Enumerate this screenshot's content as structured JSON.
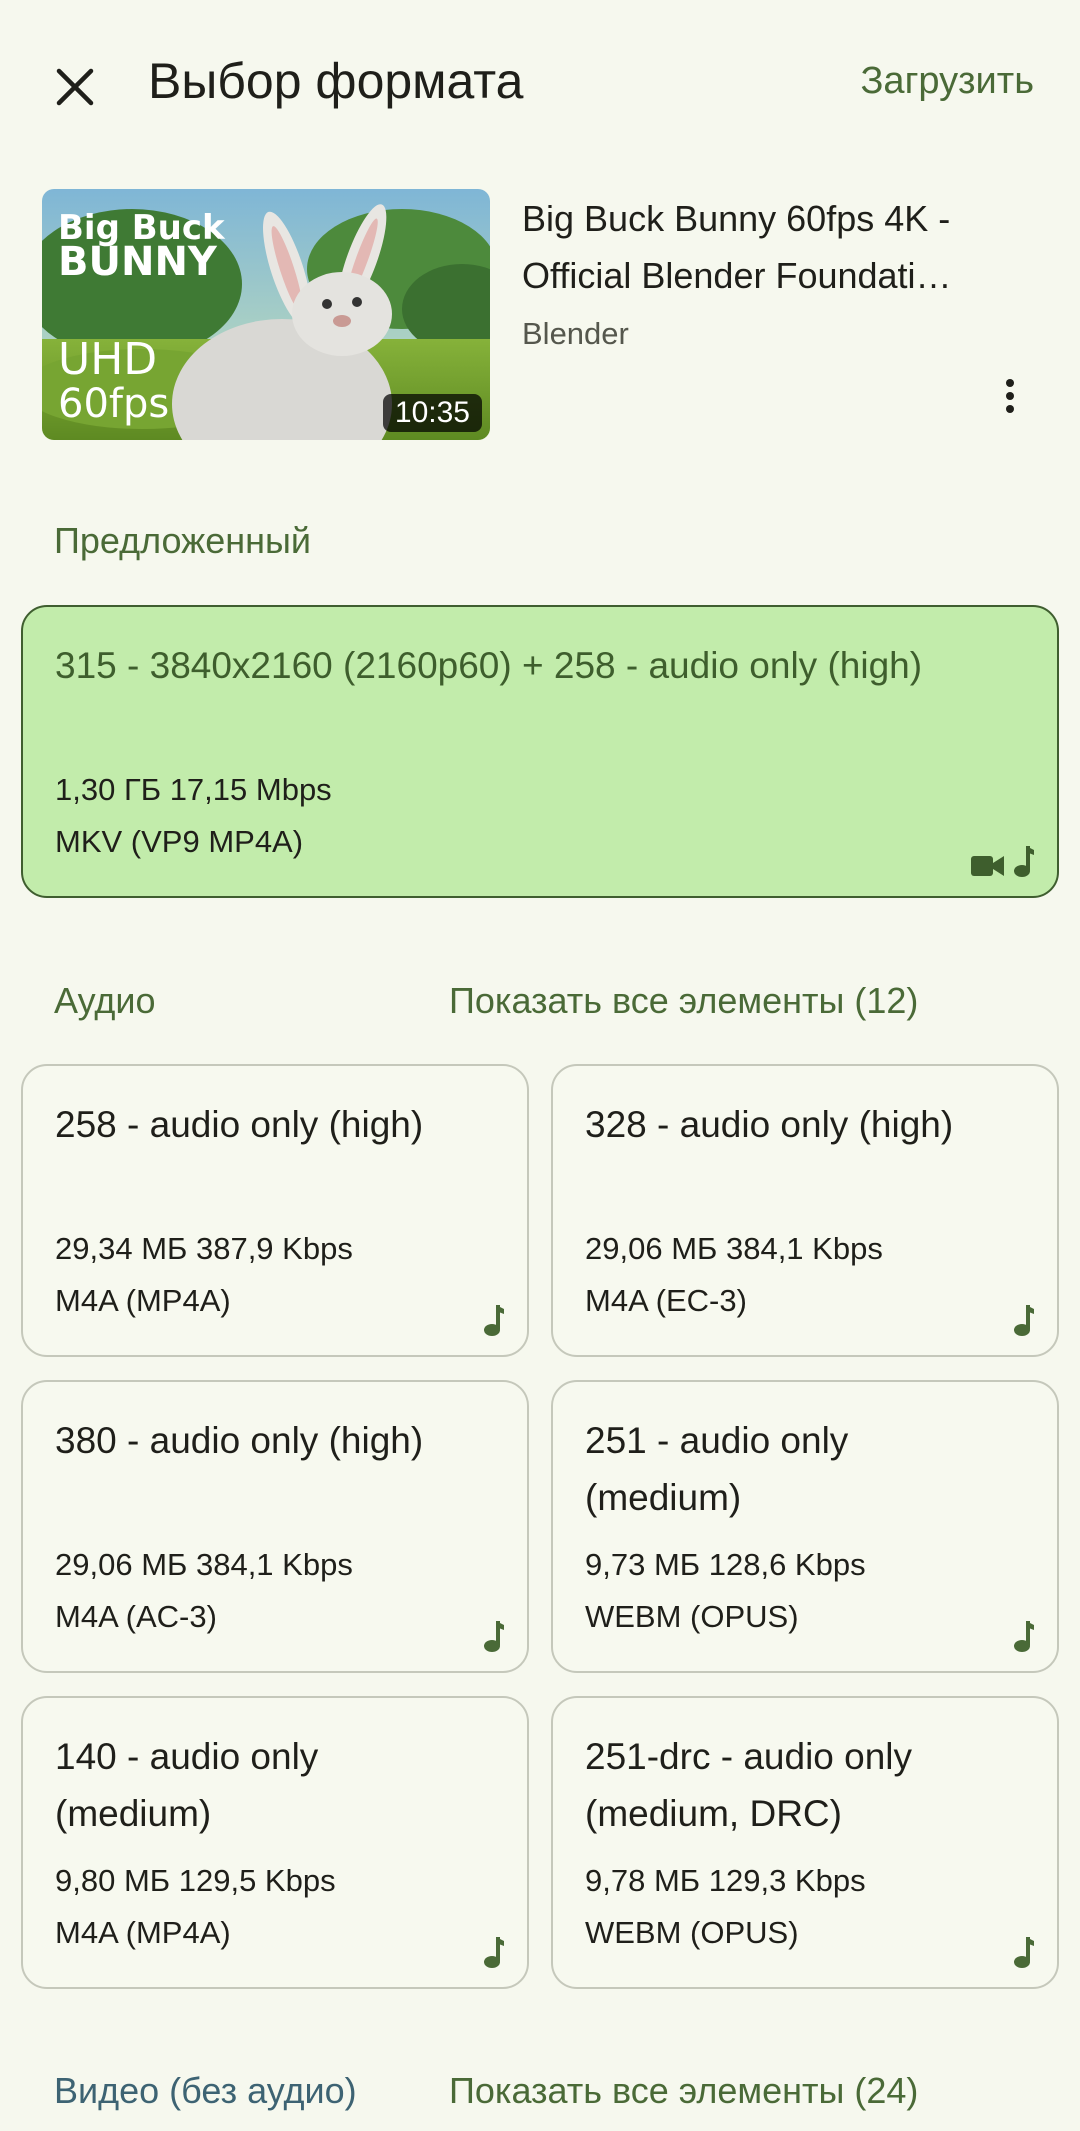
{
  "header": {
    "title": "Выбор формата",
    "download_label": "Загрузить"
  },
  "video": {
    "title_line1": "Big Buck Bunny 60fps 4K -",
    "title_line2": "Official Blender Foundati…",
    "channel": "Blender",
    "duration": "10:35",
    "thumb_text_logo1": "Big Buck",
    "thumb_text_logo2": "BUNNY",
    "thumb_text_uhd": "UHD",
    "thumb_text_fps": "60fps"
  },
  "suggested": {
    "label": "Предложенный",
    "format": "315 - 3840x2160 (2160p60) + 258 - audio only (high)",
    "size": "1,30 ГБ 17,15 Mbps",
    "codec": "MKV (VP9 MP4A)"
  },
  "audio": {
    "label": "Аудио",
    "show_all": "Показать все элементы (12)",
    "items": [
      {
        "format": "258 - audio only (high)",
        "size": "29,34 МБ 387,9 Kbps",
        "codec": "M4A (MP4A)"
      },
      {
        "format": "328 - audio only (high)",
        "size": "29,06 МБ 384,1 Kbps",
        "codec": "M4A (EC-3)"
      },
      {
        "format": "380 - audio only (high)",
        "size": "29,06 МБ 384,1 Kbps",
        "codec": "M4A (AC-3)"
      },
      {
        "format": "251 - audio only (medium)",
        "size": "9,73 МБ 128,6 Kbps",
        "codec": "WEBM (OPUS)"
      },
      {
        "format": "140 - audio only (medium)",
        "size": "9,80 МБ 129,5 Kbps",
        "codec": "M4A (MP4A)"
      },
      {
        "format": "251-drc - audio only (medium, DRC)",
        "size": "9,78 МБ 129,3 Kbps",
        "codec": "WEBM (OPUS)"
      }
    ]
  },
  "video_only": {
    "label": "Видео (без аудио)",
    "show_all": "Показать все элементы (24)"
  },
  "colors": {
    "background": "#f6f8ee",
    "accent": "#4a6a37",
    "suggested_bg": "#c2ecab",
    "video_section_label": "#3d6373"
  }
}
